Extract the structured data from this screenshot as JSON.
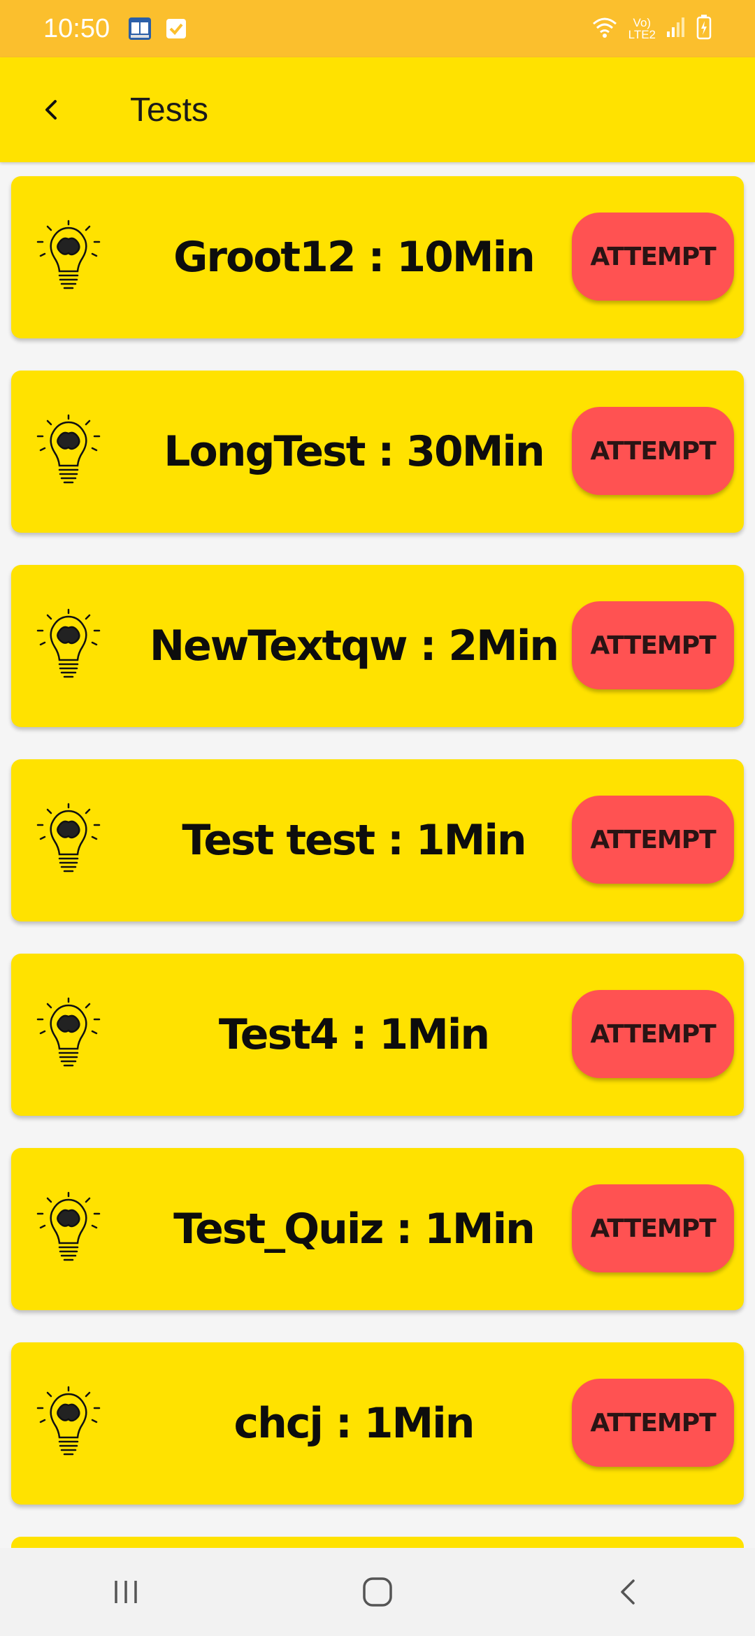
{
  "status_bar": {
    "time": "10:50",
    "network_top": "Vo)",
    "network_bottom": "LTE2"
  },
  "app_bar": {
    "title": "Tests"
  },
  "tests": [
    {
      "title": "Groot12 : 10Min",
      "action": "ATTEMPT"
    },
    {
      "title": "LongTest : 30Min",
      "action": "ATTEMPT"
    },
    {
      "title": "NewTextqw : 2Min",
      "action": "ATTEMPT"
    },
    {
      "title": "Test test : 1Min",
      "action": "ATTEMPT"
    },
    {
      "title": "Test4 : 1Min",
      "action": "ATTEMPT"
    },
    {
      "title": "Test_Quiz : 1Min",
      "action": "ATTEMPT"
    },
    {
      "title": "chcj : 1Min",
      "action": "ATTEMPT"
    }
  ],
  "colors": {
    "status_bar": "#FBBF2D",
    "app_bar": "#FFE200",
    "card": "#FFE200",
    "attempt_button": "#FF5252"
  },
  "icons": {
    "back": "chevron-left-icon",
    "test_item": "lightbulb-brain-icon"
  }
}
